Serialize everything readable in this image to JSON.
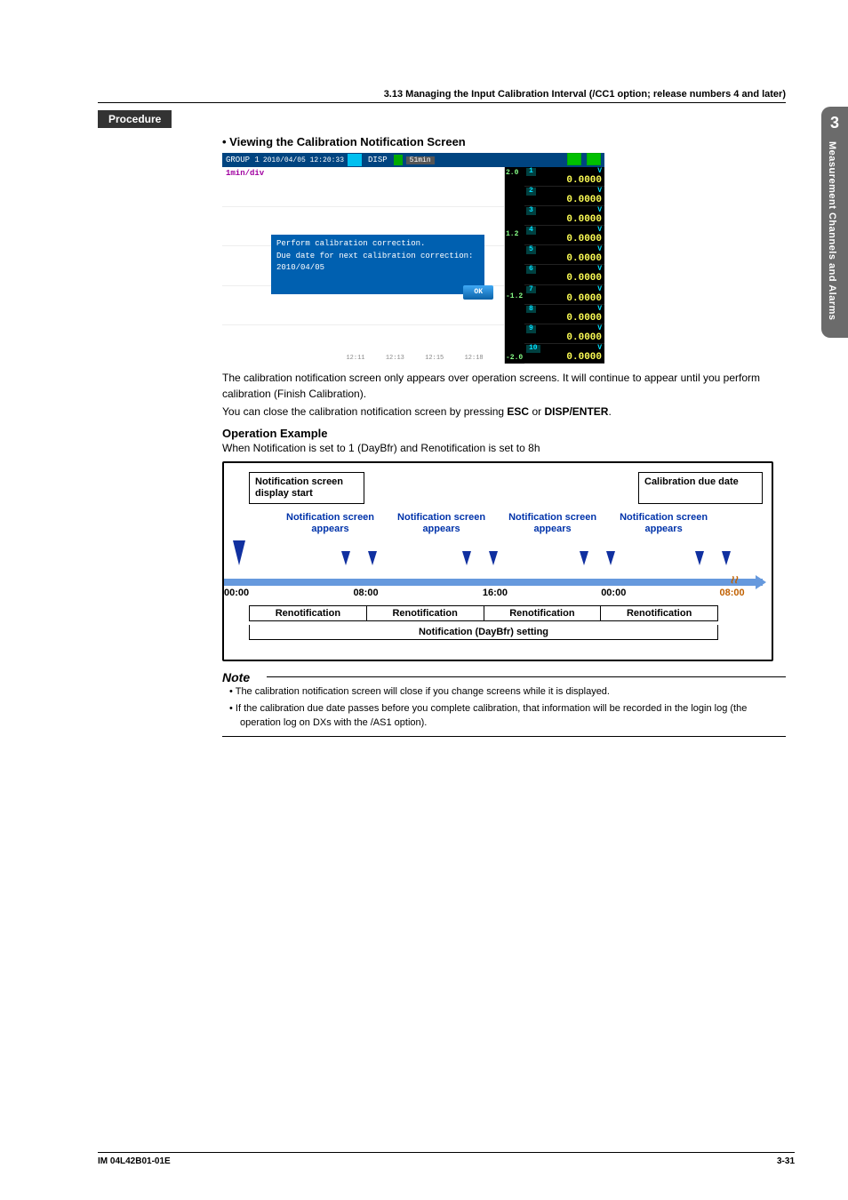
{
  "side_tab": {
    "chapter": "3",
    "label": "Measurement Channels and Alarms"
  },
  "section_header": "3.13  Managing the Input Calibration Interval (/CC1 option; release numbers 4 and later)",
  "procedure_label": "Procedure",
  "viewing_heading": "•  Viewing the Calibration Notification Screen",
  "device": {
    "group": "GROUP 1",
    "datetime": "2010/04/05 12:20:33",
    "disp_label": "DISP",
    "interval_label": "51min",
    "axis_label": "1min/div",
    "tick_labels": [
      "12:11",
      "12:13",
      "12:15",
      "12:18"
    ],
    "popup_line1": "Perform calibration correction.",
    "popup_line2": "Due date for next calibration correction: 2010/04/05",
    "ok_label": "OK",
    "scale_values": [
      "2.0",
      "1.2",
      "-1.2",
      "-2.0"
    ],
    "channels": [
      {
        "n": "1",
        "unit": "V",
        "value": "0.0000"
      },
      {
        "n": "2",
        "unit": "V",
        "value": "0.0000"
      },
      {
        "n": "3",
        "unit": "V",
        "value": "0.0000"
      },
      {
        "n": "4",
        "unit": "V",
        "value": "0.0000"
      },
      {
        "n": "5",
        "unit": "V",
        "value": "0.0000"
      },
      {
        "n": "6",
        "unit": "V",
        "value": "0.0000"
      },
      {
        "n": "7",
        "unit": "V",
        "value": "0.0000"
      },
      {
        "n": "8",
        "unit": "V",
        "value": "0.0000"
      },
      {
        "n": "9",
        "unit": "V",
        "value": "0.0000"
      },
      {
        "n": "10",
        "unit": "V",
        "value": "0.0000"
      }
    ]
  },
  "body_p1a": "The calibration notification screen only appears over operation screens. It will continue to appear until you perform calibration (Finish Calibration).",
  "body_p1b_prefix": "You can close the calibration notification screen by pressing ",
  "body_p1b_esc": "ESC",
  "body_p1b_mid": " or ",
  "body_p1b_disp": "DISP/ENTER",
  "body_p1b_suffix": ".",
  "op_example_heading": "Operation Example",
  "op_example_text": "When Notification is set to 1 (DayBfr) and Renotification is set to 8h",
  "diagram": {
    "box_left": "Notification screen display start",
    "box_right": "Calibration due date",
    "notif_label_1": "Notification screen",
    "notif_label_2": "appears",
    "ticks": [
      "00:00",
      "08:00",
      "16:00",
      "00:00",
      "08:00"
    ],
    "renotif_cell": "Renotification",
    "bottom_label": "Notification (DayBfr) setting"
  },
  "note_heading": "Note",
  "note1": "The calibration notification screen will close if you change screens while it is displayed.",
  "note2": "If the calibration due date passes before you complete calibration, that information will be recorded in the login log (the operation log on DXs with the /AS1 option).",
  "footer_left": "IM 04L42B01-01E",
  "footer_right": "3-31"
}
